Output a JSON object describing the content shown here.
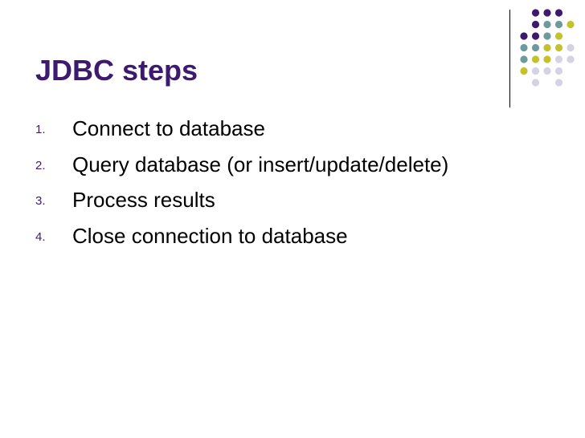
{
  "slide": {
    "title": "JDBC steps",
    "steps": [
      {
        "number": "1.",
        "text": "Connect to database"
      },
      {
        "number": "2.",
        "text": "Query database (or insert/update/delete)"
      },
      {
        "number": "3.",
        "text": "Process results"
      },
      {
        "number": "4.",
        "text": "Close connection to database"
      }
    ]
  },
  "colors": {
    "title": "#3d1a6e",
    "dot_purple": "#3d1a6e",
    "dot_teal": "#6e9a9e",
    "dot_olive": "#c4c22a",
    "dot_lavender": "#d3d3e3"
  }
}
